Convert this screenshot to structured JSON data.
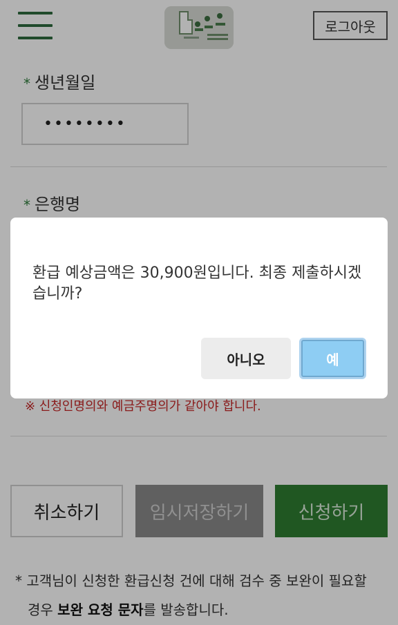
{
  "header": {
    "logout_label": "로그아웃"
  },
  "form": {
    "birth_label": "생년월일",
    "birth_value": "••••••••",
    "bank_label": "은행명",
    "required_mark": "*",
    "warning": "※ 신청인명의와 예금주명의가 같아야 합니다."
  },
  "actions": {
    "cancel_label": "취소하기",
    "temp_save_label": "임시저장하기",
    "submit_label": "신청하기"
  },
  "notice": {
    "line1": "* 고객님이 신청한 환급신청 건에 대해 검수 중 보완이 필요할",
    "line2_pre": "경우 ",
    "line2_bold": "보완 요청 문자",
    "line2_post": "를 발송합니다."
  },
  "dialog": {
    "message": "환급 예상금액은 30,900원입니다. 최종 제출하시겠습니까?",
    "no_label": "아니오",
    "yes_label": "예"
  },
  "colors": {
    "brand_green": "#2e7d32",
    "dialog_yes": "#8ecdf3",
    "warning_red": "#c62828"
  }
}
